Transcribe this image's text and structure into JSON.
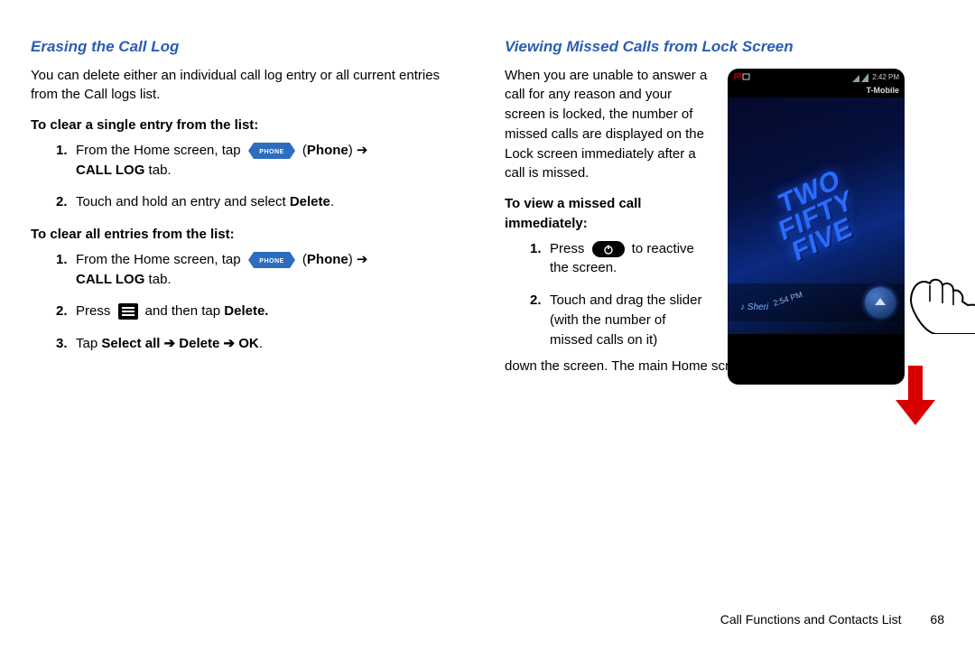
{
  "left": {
    "heading": "Erasing the Call Log",
    "intro": "You can delete either an individual call log entry or all current entries from the Call logs list.",
    "sub1": "To clear a single entry from the list:",
    "steps1": {
      "s1_a": "From the Home screen, tap ",
      "s1_b": " (",
      "s1_phone": "Phone",
      "s1_c": ") ➔ ",
      "s1_call": "CALL LOG",
      "s1_d": "  tab.",
      "s2_a": "Touch and hold an entry and select ",
      "s2_b": "Delete",
      "s2_c": "."
    },
    "sub2": "To clear all entries from the list:",
    "steps2": {
      "s1_a": "From the Home screen, tap ",
      "s1_b": " (",
      "s1_phone": "Phone",
      "s1_c": ") ➔ ",
      "s1_call": "CALL LOG",
      "s1_d": "  tab.",
      "s2_a": "Press ",
      "s2_b": " and then tap ",
      "s2_c": "Delete.",
      "s3_a": "Tap ",
      "s3_b": "Select all ➔ Delete ➔ OK",
      "s3_c": "."
    },
    "phone_tag_label": "PHONE"
  },
  "right": {
    "heading": "Viewing Missed Calls from Lock Screen",
    "intro": "When you are unable to answer a call for any reason and your screen is locked, the number of missed calls are displayed on the Lock screen immediately after a call is missed.",
    "sub1": "To view a missed call immediately:",
    "steps": {
      "s1_a": "Press ",
      "s1_b": " to reactive the screen.",
      "s2_a": "Touch and drag the slider (with the number of missed calls on it) down the screen. The main Home screen is then displayed."
    },
    "mock": {
      "status_time": "2:42 PM",
      "carrier": "T-Mobile",
      "wallpaper_text": "TWO\nFIFTY\nFIVE",
      "slider_name": "Sheri",
      "slider_time": "2:54 PM"
    }
  },
  "footer": {
    "section": "Call Functions and Contacts List",
    "page": "68"
  }
}
